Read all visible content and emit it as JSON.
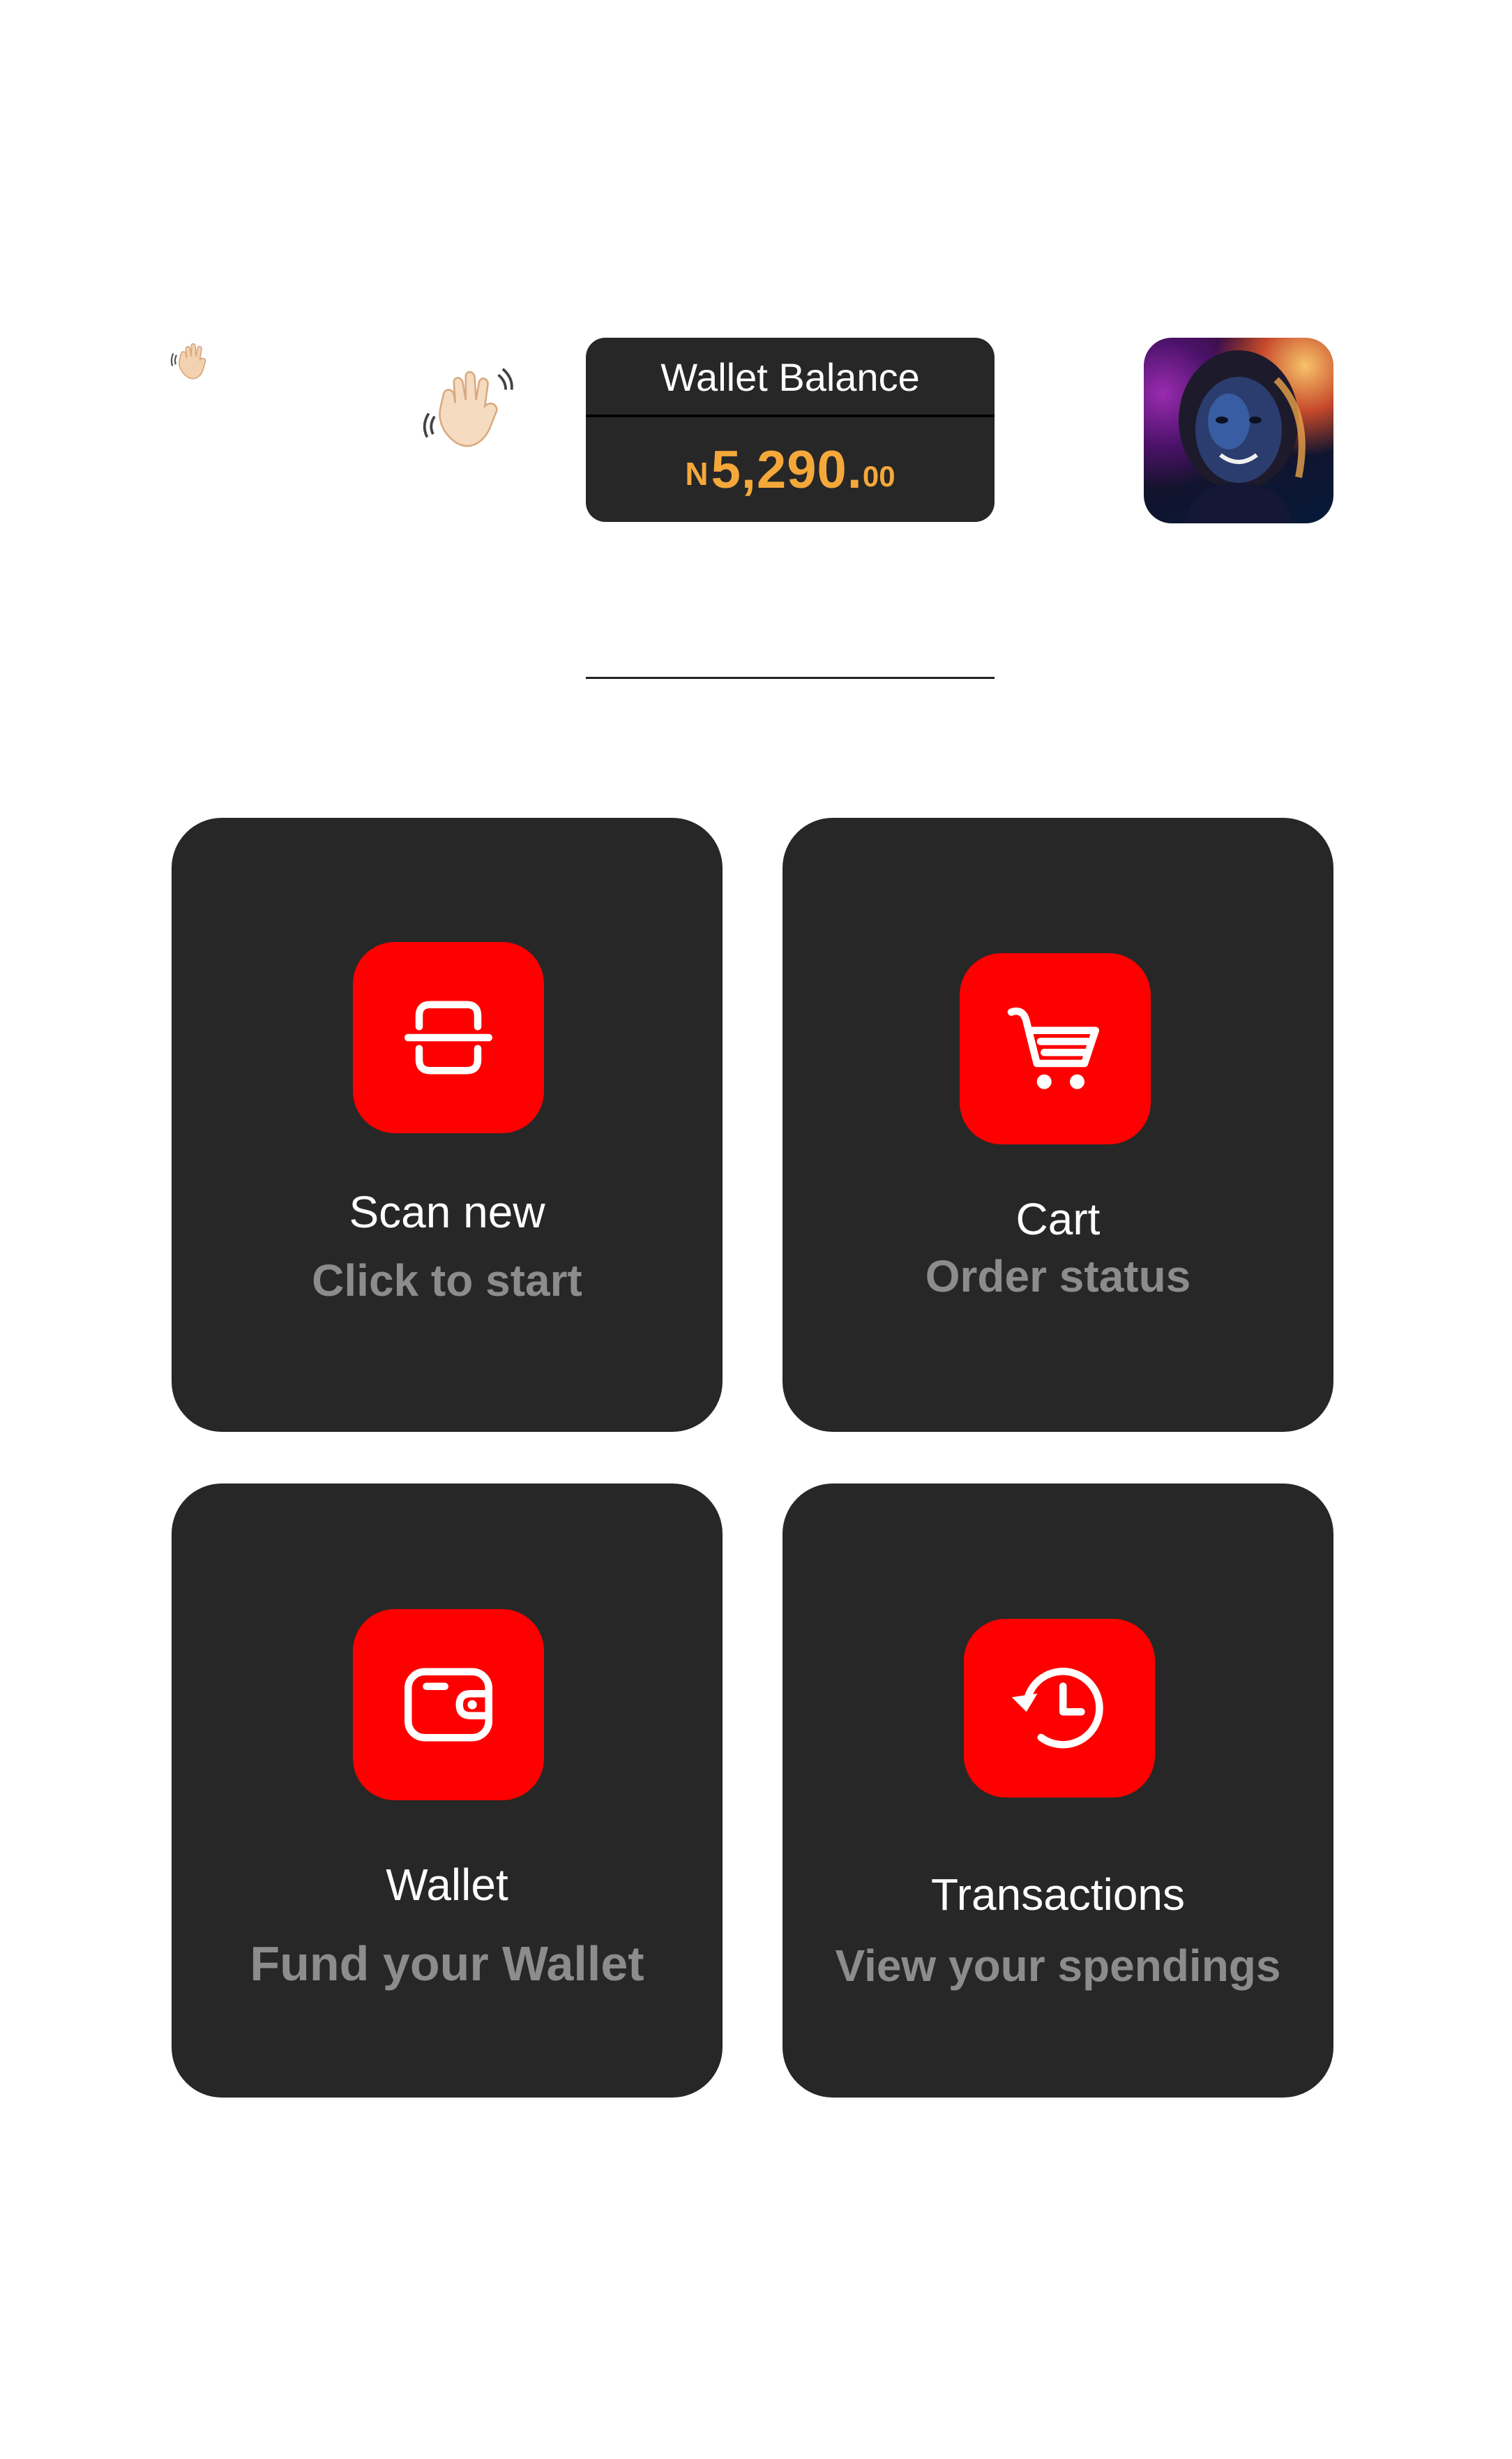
{
  "header": {
    "wave_icon_small": "waving-hand-icon",
    "wave_icon_large": "waving-hand-icon",
    "wallet_balance": {
      "title": "Wallet Balance",
      "currency": "N",
      "amount_major": "5,290.",
      "amount_minor": "00"
    },
    "avatar": "user-avatar"
  },
  "cards": {
    "scan": {
      "icon": "scan-icon",
      "title": "Scan new",
      "subtitle": "Click to start"
    },
    "cart": {
      "icon": "cart-icon",
      "title": "Cart",
      "subtitle": "Order status"
    },
    "wallet": {
      "icon": "wallet-icon",
      "title": "Wallet",
      "subtitle": "Fund your Wallet"
    },
    "transactions": {
      "icon": "history-icon",
      "title": "Transactions",
      "subtitle": "View your spendings"
    }
  },
  "colors": {
    "card_background": "#272727",
    "icon_tile": "#fe0000",
    "amount": "#f5a83a",
    "subtitle": "#8c8c8c"
  }
}
